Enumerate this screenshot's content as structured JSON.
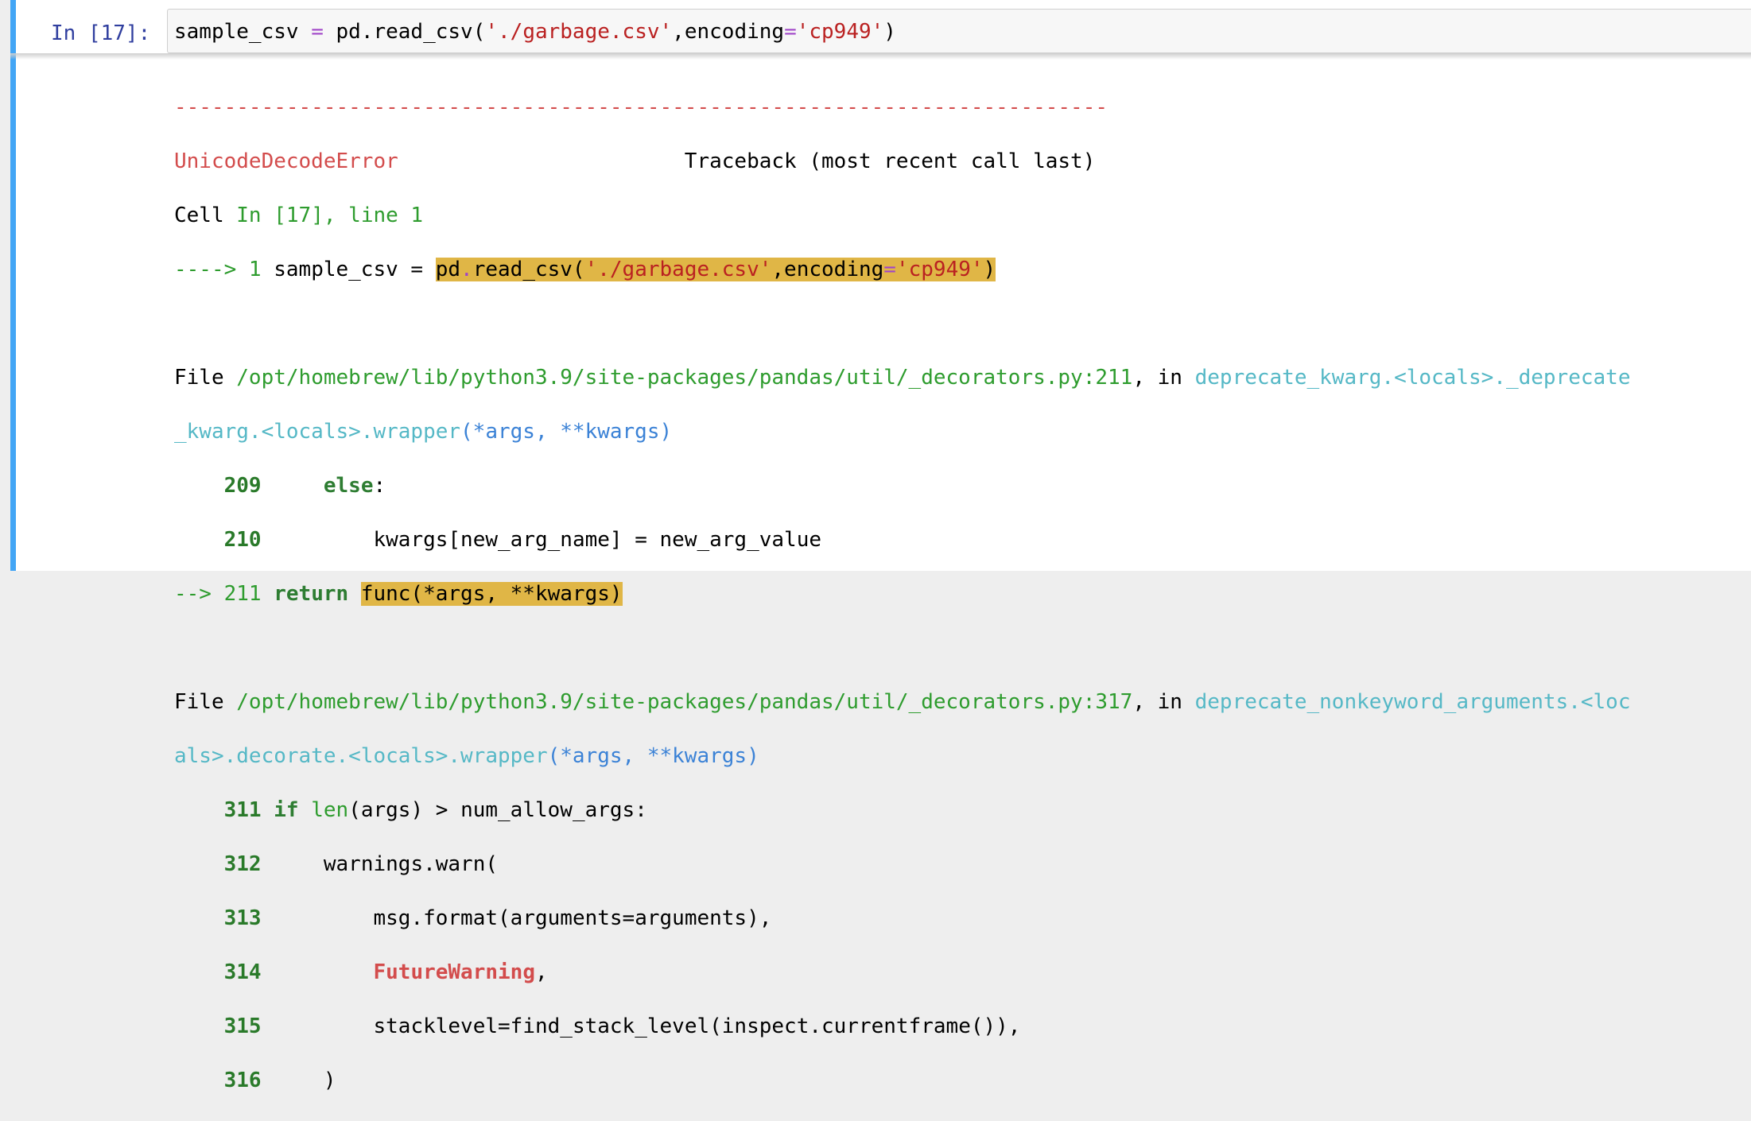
{
  "cell": {
    "prompt": "In [17]:",
    "input": {
      "var": "sample_csv",
      "eq": " = ",
      "call": "pd.read_csv(",
      "arg1": "'./garbage.csv'",
      "comma": ",encoding",
      "eq2": "=",
      "arg2": "'cp949'",
      "close": ")"
    }
  },
  "traceback": {
    "dashes": "---------------------------------------------------------------------------",
    "error_name": "UnicodeDecodeError",
    "header": "Traceback (most recent call last)",
    "cell_ref": {
      "prefix": "Cell ",
      "link": "In [17], line 1"
    },
    "line1": {
      "arrow": "----> 1 ",
      "pre": "sample_csv = ",
      "hl_pd": "pd",
      "hl_dot": ".",
      "hl_call": "read_csv(",
      "hl_arg1": "'./garbage.csv'",
      "hl_enc": ",encoding",
      "hl_eq": "=",
      "hl_arg2": "'cp949'",
      "hl_close": ")"
    },
    "frame1": {
      "file_label": "File ",
      "path": "/opt/homebrew/lib/python3.9/site-packages/pandas/util/_decorators.py:211",
      "in_label": ", in ",
      "func_a": "deprecate_kwarg.<locals>._deprecate",
      "func_b": "_kwarg.<locals>.wrapper",
      "args": "(*args, **kwargs)",
      "l209_num": "209",
      "l209_code": "else",
      "l209_colon": ":",
      "l210_num": "210",
      "l210_code": "kwargs[new_arg_name] = new_arg_value",
      "l211_arrow": "--> 211 ",
      "l211_kw": "return",
      "l211_hl": "func(*args, **kwargs)"
    },
    "frame2": {
      "file_label": "File ",
      "path": "/opt/homebrew/lib/python3.9/site-packages/pandas/util/_decorators.py:317",
      "in_label": ", in ",
      "func_a": "deprecate_nonkeyword_arguments.<loc",
      "func_b": "als>.decorate.<locals>.wrapper",
      "args": "(*args, **kwargs)",
      "l311_num": "311",
      "l311_kw": "if",
      "l311_fn": "len",
      "l311_rest": "(args) > num_allow_args:",
      "l312_num": "312",
      "l312_code": "warnings.warn(",
      "l313_num": "313",
      "l313_code": "msg.format(arguments=arguments),",
      "l314_num": "314",
      "l314_code": "FutureWarning",
      "l314_comma": ",",
      "l315_num": "315",
      "l315_code": "stacklevel=find_stack_level(inspect.currentframe()),",
      "l316_num": "316",
      "l316_code": ")"
    }
  }
}
